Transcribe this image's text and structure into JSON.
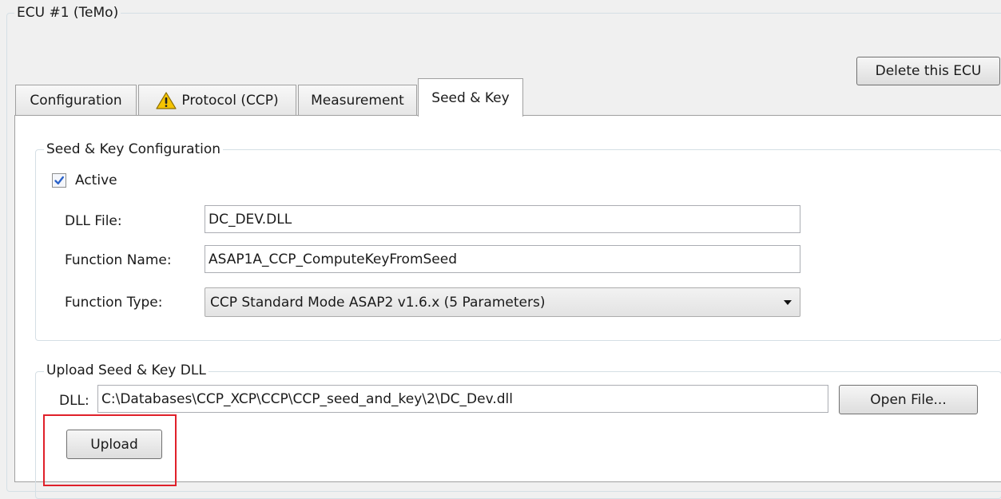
{
  "ecu": {
    "title": "ECU #1 (TeMo)",
    "delete_button": "Delete this ECU"
  },
  "tabs": [
    {
      "label": "Configuration",
      "icon": null,
      "active": false
    },
    {
      "label": "Protocol (CCP)",
      "icon": "warning-icon",
      "active": false
    },
    {
      "label": "Measurement",
      "icon": null,
      "active": false
    },
    {
      "label": "Seed & Key",
      "icon": null,
      "active": true
    }
  ],
  "seed_key_config": {
    "title": "Seed & Key Configuration",
    "active_label": "Active",
    "active_checked": true,
    "dll_file_label": "DLL File:",
    "dll_file_value": "DC_DEV.DLL",
    "function_name_label": "Function Name:",
    "function_name_value": "ASAP1A_CCP_ComputeKeyFromSeed",
    "function_type_label": "Function Type:",
    "function_type_value": "CCP Standard Mode ASAP2 v1.6.x (5 Parameters)"
  },
  "upload": {
    "title": "Upload Seed & Key DLL",
    "dll_label": "DLL:",
    "dll_path": "C:\\Databases\\CCP_XCP\\CCP\\CCP_seed_and_key\\2\\DC_Dev.dll",
    "open_file_button": "Open File...",
    "upload_button": "Upload"
  },
  "colors": {
    "highlight": "#e0202a",
    "warning": "#f5c400",
    "check": "#2a62c9"
  }
}
